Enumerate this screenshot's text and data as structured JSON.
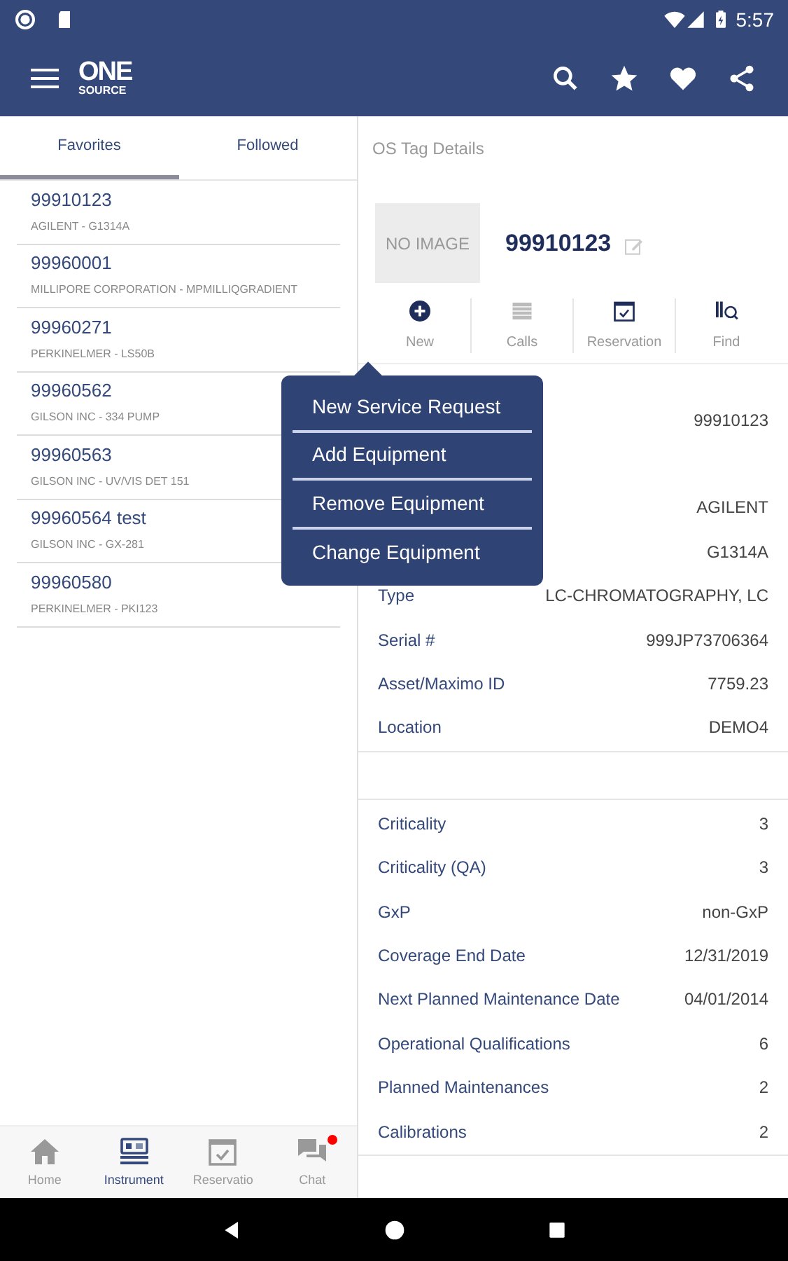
{
  "status_bar": {
    "time": "5:57"
  },
  "app_bar": {
    "logo_top": "ONE",
    "logo_bottom": "SOURCE"
  },
  "tabs": [
    {
      "label": "Favorites",
      "selected": true
    },
    {
      "label": "Followed",
      "selected": false
    }
  ],
  "instruments": [
    {
      "id": "99910123",
      "subtitle": "AGILENT - G1314A"
    },
    {
      "id": "99960001",
      "subtitle": "MILLIPORE CORPORATION - MPMILLIQGRADIENT"
    },
    {
      "id": "99960271",
      "subtitle": "PERKINELMER - LS50B"
    },
    {
      "id": "99960562",
      "subtitle": "GILSON INC - 334 PUMP"
    },
    {
      "id": "99960563",
      "subtitle": "GILSON INC - UV/VIS DET 151"
    },
    {
      "id": "99960564 test",
      "subtitle": "GILSON INC - GX-281"
    },
    {
      "id": "99960580",
      "subtitle": "PERKINELMER - PKI123"
    }
  ],
  "detail": {
    "title": "OS Tag Details",
    "image_placeholder": "NO IMAGE",
    "tag": "99910123",
    "actions": [
      {
        "label": "New",
        "kind": "new",
        "active": true
      },
      {
        "label": "Calls",
        "kind": "calls",
        "active": false
      },
      {
        "label": "Reservation",
        "kind": "reservation",
        "active": true
      },
      {
        "label": "Find",
        "kind": "find",
        "active": true
      }
    ],
    "info_rows": [
      {
        "value": "99910123"
      },
      {
        "value": "AGILENT",
        "gap_before": true
      },
      {
        "value": "G1314A"
      },
      {
        "label": "Type",
        "value": "LC-CHROMATOGRAPHY, LC"
      },
      {
        "label": "Serial #",
        "value": "999JP73706364"
      },
      {
        "label": "Asset/Maximo ID",
        "value": "7759.23"
      },
      {
        "label": "Location",
        "value": "DEMO4"
      }
    ],
    "stats_rows": [
      {
        "label": "Criticality",
        "value": "3"
      },
      {
        "label": "Criticality (QA)",
        "value": "3"
      },
      {
        "label": "GxP",
        "value": "non-GxP"
      },
      {
        "label": "Coverage End Date",
        "value": "12/31/2019"
      },
      {
        "label": "Next Planned Maintenance Date",
        "value": "04/01/2014"
      },
      {
        "label": "Operational Qualifications",
        "value": "6"
      },
      {
        "label": "Planned Maintenances",
        "value": "2"
      },
      {
        "label": "Calibrations",
        "value": "2"
      }
    ]
  },
  "popup_menu": [
    "New Service Request",
    "Add Equipment",
    "Remove Equipment",
    "Change Equipment"
  ],
  "bottom_nav": [
    {
      "label": "Home",
      "kind": "home",
      "selected": false,
      "notification": false
    },
    {
      "label": "Instrument",
      "kind": "instrument",
      "selected": true,
      "notification": false
    },
    {
      "label": "Reservatio",
      "kind": "reservation",
      "selected": false,
      "notification": false
    },
    {
      "label": "Chat",
      "kind": "chat",
      "selected": false,
      "notification": true
    }
  ]
}
